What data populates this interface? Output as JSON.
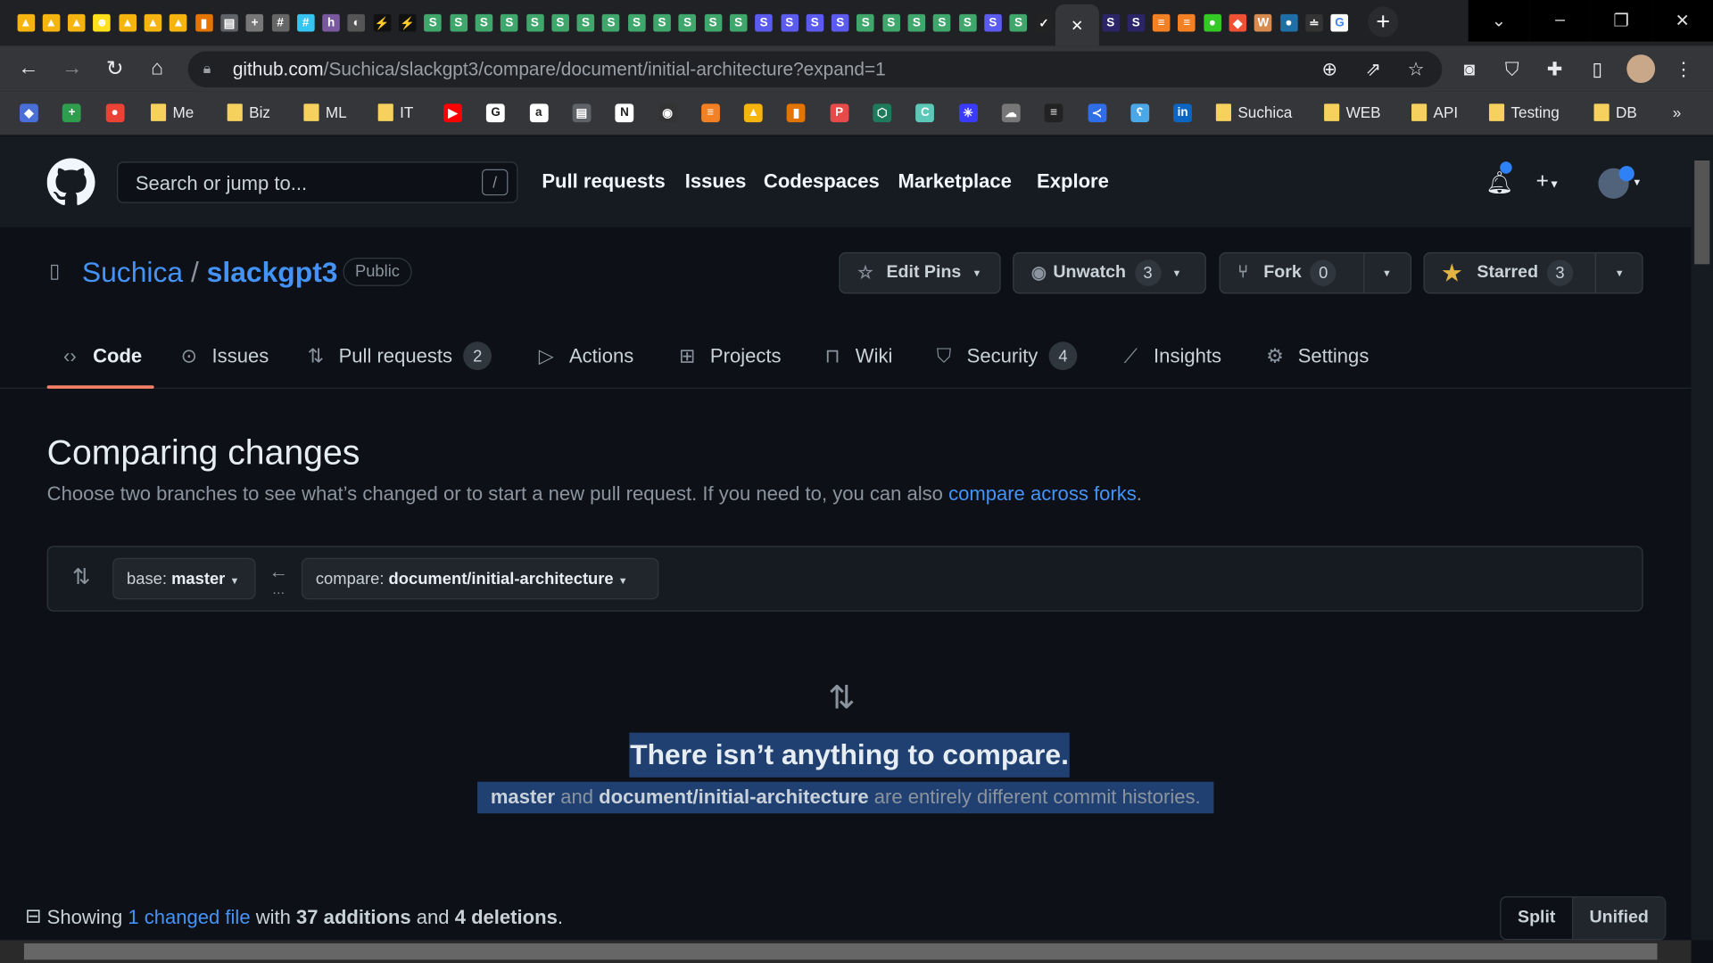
{
  "browser": {
    "tabs": [
      {
        "icon": "firebase-icon",
        "letter": "▲",
        "color": "#f6b40e"
      },
      {
        "icon": "firebase-icon",
        "letter": "▲",
        "color": "#f6b40e"
      },
      {
        "icon": "firebase-icon",
        "letter": "▲",
        "color": "#f6b40e"
      },
      {
        "icon": "mailchimp-icon",
        "letter": "☻",
        "color": "#ffe01b"
      },
      {
        "icon": "firebase-icon",
        "letter": "▲",
        "color": "#f6b40e"
      },
      {
        "icon": "firebase-icon",
        "letter": "▲",
        "color": "#f6b40e"
      },
      {
        "icon": "firebase-icon",
        "letter": "▲",
        "color": "#f6b40e"
      },
      {
        "icon": "analytics-icon",
        "letter": "▮",
        "color": "#e37400"
      },
      {
        "icon": "store-icon",
        "letter": "▤",
        "color": "#5f6368"
      },
      {
        "icon": "plus-box-icon",
        "letter": "+",
        "color": "#777"
      },
      {
        "icon": "slack-icon",
        "letter": "#",
        "color": "#666"
      },
      {
        "icon": "slack-icon",
        "letter": "#",
        "color": "#36c5f0"
      },
      {
        "icon": "heroku-icon",
        "letter": "h",
        "color": "#79589f"
      },
      {
        "icon": "globe-icon",
        "letter": "◐",
        "color": "#555"
      },
      {
        "icon": "zap-icon",
        "letter": "⚡",
        "color": "#111"
      },
      {
        "icon": "zap-icon",
        "letter": "⚡",
        "color": "#111"
      },
      {
        "icon": "s-green-icon",
        "letter": "S",
        "color": "#3fa66c"
      },
      {
        "icon": "s-green-icon",
        "letter": "S",
        "color": "#3fa66c"
      },
      {
        "icon": "s-green-icon",
        "letter": "S",
        "color": "#3fa66c"
      },
      {
        "icon": "s-green-icon",
        "letter": "S",
        "color": "#3fa66c"
      },
      {
        "icon": "s-green-icon",
        "letter": "S",
        "color": "#3fa66c"
      },
      {
        "icon": "s-green-icon",
        "letter": "S",
        "color": "#3fa66c"
      },
      {
        "icon": "s-green-icon",
        "letter": "S",
        "color": "#3fa66c"
      },
      {
        "icon": "s-green-icon",
        "letter": "S",
        "color": "#3fa66c"
      },
      {
        "icon": "s-green-icon",
        "letter": "S",
        "color": "#3fa66c"
      },
      {
        "icon": "s-green-icon",
        "letter": "S",
        "color": "#3fa66c"
      },
      {
        "icon": "s-green-icon",
        "letter": "S",
        "color": "#3fa66c"
      },
      {
        "icon": "s-green-icon",
        "letter": "S",
        "color": "#3fa66c"
      },
      {
        "icon": "s-green-icon",
        "letter": "S",
        "color": "#3fa66c"
      },
      {
        "icon": "s-blue-icon",
        "letter": "S",
        "color": "#5b5bf0"
      },
      {
        "icon": "s-blue-icon",
        "letter": "S",
        "color": "#5b5bf0"
      },
      {
        "icon": "s-blue-icon",
        "letter": "S",
        "color": "#5b5bf0"
      },
      {
        "icon": "s-blue-icon",
        "letter": "S",
        "color": "#5b5bf0"
      },
      {
        "icon": "s-green-icon",
        "letter": "S",
        "color": "#3fa66c"
      },
      {
        "icon": "s-green-icon",
        "letter": "S",
        "color": "#3fa66c"
      },
      {
        "icon": "s-green-icon",
        "letter": "S",
        "color": "#3fa66c"
      },
      {
        "icon": "s-green-icon",
        "letter": "S",
        "color": "#3fa66c"
      },
      {
        "icon": "s-green-icon",
        "letter": "S",
        "color": "#3fa66c"
      },
      {
        "icon": "s-blue-icon",
        "letter": "S",
        "color": "#5b5bf0"
      },
      {
        "icon": "s-green-icon",
        "letter": "S",
        "color": "#3fa66c"
      },
      {
        "icon": "github-check-icon",
        "letter": "✓",
        "color": "#222"
      }
    ],
    "active_tab": {
      "close": "✕"
    },
    "tabs_after": [
      {
        "icon": "s-dark-icon",
        "letter": "S",
        "color": "#2b2466"
      },
      {
        "icon": "s-dark-icon",
        "letter": "S",
        "color": "#2b2466"
      },
      {
        "icon": "stackoverflow-icon",
        "letter": "≡",
        "color": "#f48024"
      },
      {
        "icon": "stackoverflow-icon",
        "letter": "≡",
        "color": "#f48024"
      },
      {
        "icon": "green-circle-icon",
        "letter": "●",
        "color": "#34c924"
      },
      {
        "icon": "git-icon",
        "letter": "◆",
        "color": "#f05033"
      },
      {
        "icon": "w-icon",
        "letter": "W",
        "color": "#d98a4f"
      },
      {
        "icon": "blue-circle-icon",
        "letter": "●",
        "color": "#1e6fa8"
      },
      {
        "icon": "misc-icon",
        "letter": "≐",
        "color": "#333"
      },
      {
        "icon": "google-icon",
        "letter": "G",
        "color": "#fff"
      }
    ],
    "new_tab": "+",
    "window": {
      "tab_search": "⌄",
      "minimize": "–",
      "restore": "❐",
      "close": "✕"
    },
    "url_host": "github.com",
    "url_path": "/Suchica/slackgpt3/compare/document/initial-architecture?expand=1",
    "bookmarks_left_icons": [
      {
        "icon": "layers-icon",
        "letter": "◆",
        "color": "#4a6fd6"
      },
      {
        "icon": "sheets-plus-icon",
        "letter": "+",
        "color": "#2e9d4e"
      },
      {
        "icon": "maps-icon",
        "letter": "●",
        "color": "#ea4335"
      }
    ],
    "bookmark_folders_left": [
      "Me",
      "Biz",
      "ML",
      "IT"
    ],
    "bookmarks_mid_icons": [
      {
        "icon": "youtube-icon",
        "letter": "▶",
        "color": "#f00"
      },
      {
        "icon": "google-icon",
        "letter": "G",
        "color": "#fff"
      },
      {
        "icon": "amazon-icon",
        "letter": "a",
        "color": "#fff"
      },
      {
        "icon": "store-icon",
        "letter": "▤",
        "color": "#5f6368"
      },
      {
        "icon": "notion-icon",
        "letter": "N",
        "color": "#fff"
      },
      {
        "icon": "github-icon",
        "letter": "◉",
        "color": "#333"
      },
      {
        "icon": "stackoverflow-icon",
        "letter": "≡",
        "color": "#f48024"
      },
      {
        "icon": "firebase-icon",
        "letter": "▲",
        "color": "#f6b40e"
      },
      {
        "icon": "analytics-icon",
        "letter": "▮",
        "color": "#e37400"
      },
      {
        "icon": "p-icon",
        "letter": "P",
        "color": "#e84a4a"
      },
      {
        "icon": "hex-icon",
        "letter": "⬡",
        "color": "#1e7a5a"
      },
      {
        "icon": "c-icon",
        "letter": "C",
        "color": "#5cc8b8"
      },
      {
        "icon": "asterisk-icon",
        "letter": "✳",
        "color": "#3b3bff"
      },
      {
        "icon": "cloud-icon",
        "letter": "☁",
        "color": "#777"
      },
      {
        "icon": "menu-icon",
        "letter": "≡",
        "color": "#222"
      },
      {
        "icon": "arrow-icon",
        "letter": "≺",
        "color": "#2f6ee8"
      },
      {
        "icon": "bear-icon",
        "letter": "ʕ",
        "color": "#4aa8e8"
      },
      {
        "icon": "linkedin-icon",
        "letter": "in",
        "color": "#0a66c2"
      }
    ],
    "bookmark_folders_right": [
      "Suchica",
      "WEB",
      "API",
      "Testing",
      "DB"
    ],
    "bookmarks_more": "»"
  },
  "github": {
    "search_placeholder": "Search or jump to...",
    "search_shortcut": "/",
    "nav": [
      "Pull requests",
      "Issues",
      "Codespaces",
      "Marketplace",
      "Explore"
    ],
    "owner": "Suchica",
    "repo": "slackgpt3",
    "visibility": "Public",
    "actions": {
      "edit_pins": "Edit Pins",
      "unwatch": "Unwatch",
      "watch_count": "3",
      "fork": "Fork",
      "fork_count": "0",
      "starred": "Starred",
      "star_count": "3"
    },
    "tabs": [
      {
        "label": "Code",
        "icon": "code-icon",
        "glyph": "‹›"
      },
      {
        "label": "Issues",
        "icon": "issue-icon",
        "glyph": "⊙"
      },
      {
        "label": "Pull requests",
        "icon": "pull-request-icon",
        "glyph": "⇅",
        "count": "2"
      },
      {
        "label": "Actions",
        "icon": "play-icon",
        "glyph": "▷"
      },
      {
        "label": "Projects",
        "icon": "table-icon",
        "glyph": "⊞"
      },
      {
        "label": "Wiki",
        "icon": "book-icon",
        "glyph": "⊓"
      },
      {
        "label": "Security",
        "icon": "shield-icon",
        "glyph": "⛉",
        "count": "4"
      },
      {
        "label": "Insights",
        "icon": "graph-icon",
        "glyph": "⟋"
      },
      {
        "label": "Settings",
        "icon": "gear-icon",
        "glyph": "⚙"
      }
    ],
    "accent": "#f78166",
    "link_color": "#4493f8"
  },
  "compare": {
    "title": "Comparing changes",
    "description": "Choose two branches to see what’s changed or to start a new pull request. If you need to, you can also ",
    "forks_link": "compare across forks",
    "period": ".",
    "base_label": "base:",
    "base_value": "master",
    "compare_label": "compare:",
    "compare_value": "document/initial-architecture",
    "empty_title": "There isn’t anything to compare.",
    "empty_base": "master",
    "empty_and": " and ",
    "empty_compare": "document/initial-architecture",
    "empty_rest": " are entirely different commit histories.",
    "summary_showing": "Showing ",
    "summary_link": "1 changed file",
    "summary_with": " with ",
    "summary_additions": "37 additions",
    "summary_and": " and ",
    "summary_deletions": "4 deletions",
    "summary_end": ".",
    "view_split": "Split",
    "view_unified": "Unified"
  }
}
